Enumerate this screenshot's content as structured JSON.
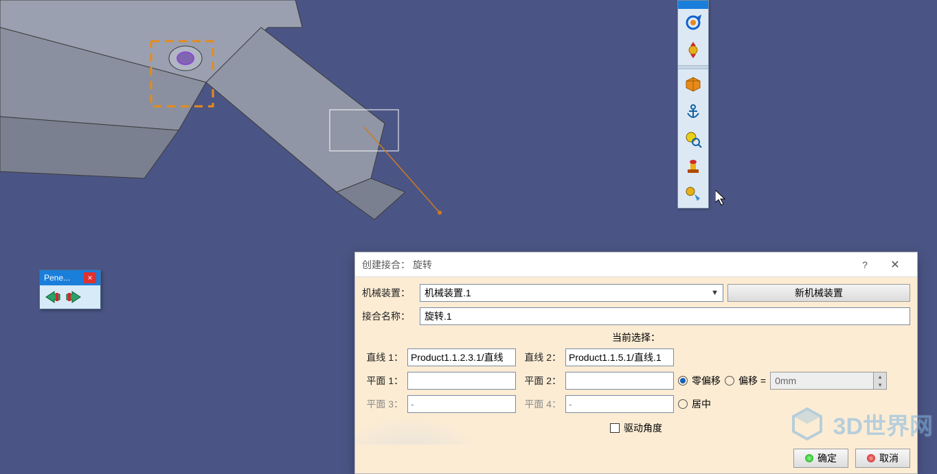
{
  "pene": {
    "title": "Pene...",
    "close": "×"
  },
  "toolbar_icons": [
    "gear-rotate-icon",
    "gear-arrows-icon",
    "cube-icon",
    "anchor-icon",
    "gear-magnify-icon",
    "stamp-icon",
    "gear-process-icon"
  ],
  "dialog": {
    "title": "创建接合：  旋转",
    "help": "?",
    "close": "✕",
    "mechanism_label": "机械装置：",
    "mechanism_value": "机械装置.1",
    "new_mechanism": "新机械装置",
    "joint_name_label": "接合名称：",
    "joint_name_value": "旋转.1",
    "current_selection": "当前选择：",
    "line1_label": "直线 1：",
    "line1_value": "Product1.1.2.3.1/直线",
    "line2_label": "直线 2：",
    "line2_value": "Product1.1.5.1/直线.1",
    "plane1_label": "平面 1：",
    "plane1_value": "",
    "plane2_label": "平面 2：",
    "plane2_value": "",
    "zero_offset": "零偏移",
    "offset_label": "偏移 =",
    "offset_value": "0mm",
    "plane3_label": "平面 3：",
    "plane3_value": "-",
    "plane4_label": "平面 4：",
    "plane4_value": "-",
    "center": "居中",
    "drive_angle": "驱动角度",
    "ok": "确定",
    "cancel": "取消"
  },
  "watermark": {
    "text": "3D世界网"
  }
}
